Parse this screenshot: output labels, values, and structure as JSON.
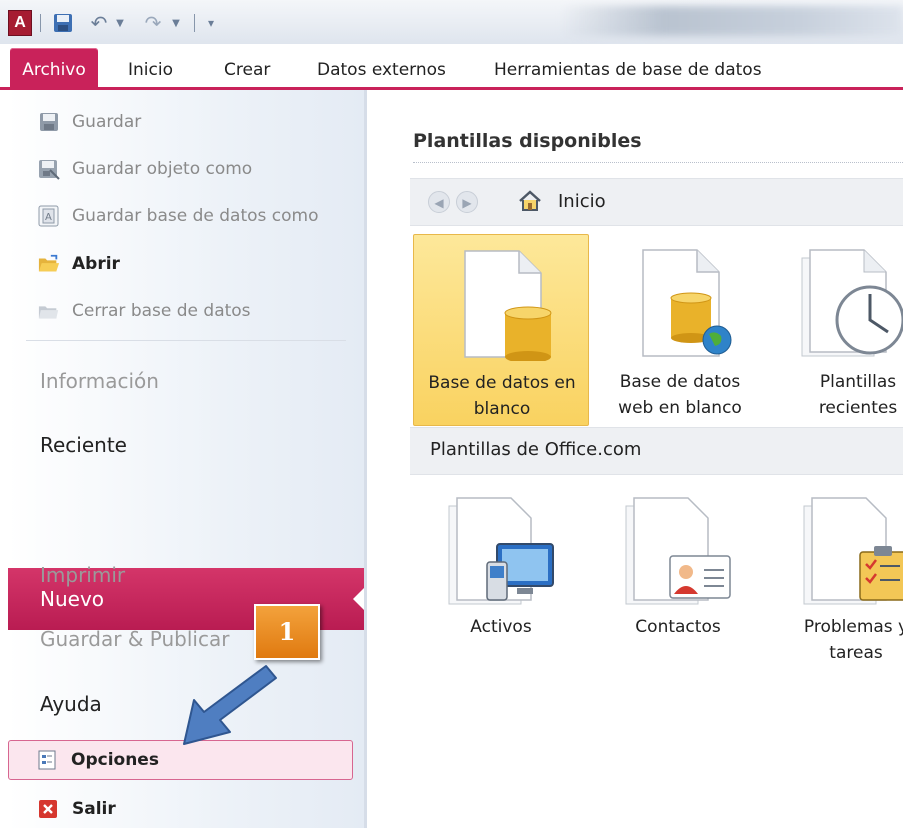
{
  "quick_access": {
    "app_icon": "A",
    "icons": [
      "access-app-icon",
      "save-icon",
      "undo-icon",
      "redo-icon",
      "customize-icon"
    ]
  },
  "ribbon": {
    "tabs": [
      "Archivo",
      "Inicio",
      "Crear",
      "Datos externos",
      "Herramientas de base de datos"
    ],
    "active_tab": "Archivo",
    "accent_color": "#c9225a"
  },
  "backstage": {
    "commands": [
      {
        "label": "Guardar",
        "icon": "save-icon",
        "enabled": false
      },
      {
        "label": "Guardar objeto como",
        "icon": "save-object-icon",
        "enabled": false
      },
      {
        "label": "Guardar base de datos como",
        "icon": "save-db-icon",
        "enabled": false
      },
      {
        "label": "Abrir",
        "icon": "open-folder-icon",
        "enabled": true
      },
      {
        "label": "Cerrar base de datos",
        "icon": "close-db-icon",
        "enabled": false
      }
    ],
    "sections": [
      {
        "label": "Información",
        "enabled": false
      },
      {
        "label": "Reciente",
        "enabled": true
      },
      {
        "label": "Nuevo",
        "enabled": true,
        "selected": true
      },
      {
        "label": "Imprimir",
        "enabled": false
      },
      {
        "label": "Guardar & Publicar",
        "enabled": false
      },
      {
        "label": "Ayuda",
        "enabled": true
      }
    ],
    "options": {
      "label": "Opciones",
      "icon": "options-icon",
      "highlighted": true
    },
    "exit": {
      "label": "Salir",
      "icon": "exit-icon"
    }
  },
  "annotation": {
    "callout_number": "1",
    "arrow_icon": "pointer-arrow-icon"
  },
  "templates": {
    "title": "Plantillas disponibles",
    "nav": {
      "label": "Inicio",
      "icons": [
        "back-icon",
        "forward-icon",
        "home-icon"
      ]
    },
    "available": [
      {
        "line1": "Base de datos en",
        "line2": "blanco",
        "selected": true
      },
      {
        "line1": "Base de datos",
        "line2": "web en blanco",
        "selected": false
      },
      {
        "line1": "Plantillas",
        "line2": "recientes",
        "selected": false
      }
    ],
    "office_section": "Plantillas de Office.com",
    "office": [
      {
        "line1": "Activos",
        "line2": ""
      },
      {
        "line1": "Contactos",
        "line2": ""
      },
      {
        "line1": "Problemas y",
        "line2": "tareas"
      }
    ]
  }
}
